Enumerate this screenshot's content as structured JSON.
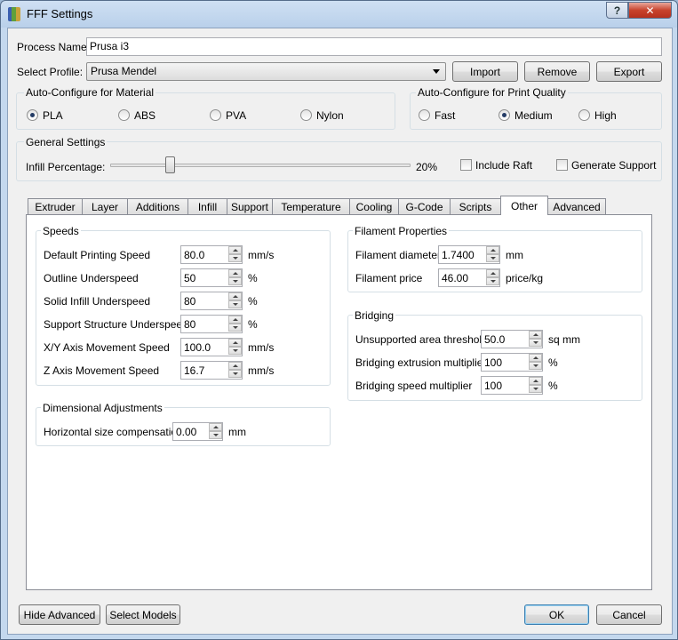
{
  "window": {
    "title": "FFF Settings",
    "help_label": "?",
    "close_label": "✕"
  },
  "process": {
    "name_label": "Process Name:",
    "name_value": "Prusa i3"
  },
  "profile": {
    "label": "Select Profile:",
    "selected": "Prusa Mendel",
    "import_label": "Import",
    "remove_label": "Remove",
    "export_label": "Export"
  },
  "material": {
    "title": "Auto-Configure for Material",
    "options": [
      "PLA",
      "ABS",
      "PVA",
      "Nylon"
    ],
    "selected": "PLA"
  },
  "quality": {
    "title": "Auto-Configure for Print Quality",
    "options": [
      "Fast",
      "Medium",
      "High"
    ],
    "selected": "Medium"
  },
  "general": {
    "title": "General Settings",
    "infill_label": "Infill Percentage:",
    "infill_value_text": "20%",
    "infill_fraction": 0.2,
    "include_raft_label": "Include Raft",
    "include_raft_checked": false,
    "generate_support_label": "Generate Support",
    "generate_support_checked": false
  },
  "tabs": [
    "Extruder",
    "Layer",
    "Additions",
    "Infill",
    "Support",
    "Temperature",
    "Cooling",
    "G-Code",
    "Scripts",
    "Other",
    "Advanced"
  ],
  "active_tab": "Other",
  "speeds": {
    "title": "Speeds",
    "rows": [
      {
        "label": "Default Printing Speed",
        "value": "80.0",
        "unit": "mm/s"
      },
      {
        "label": "Outline Underspeed",
        "value": "50",
        "unit": "%"
      },
      {
        "label": "Solid Infill Underspeed",
        "value": "80",
        "unit": "%"
      },
      {
        "label": "Support Structure Underspeed",
        "value": "80",
        "unit": "%"
      },
      {
        "label": "X/Y Axis Movement Speed",
        "value": "100.0",
        "unit": "mm/s"
      },
      {
        "label": "Z Axis Movement Speed",
        "value": "16.7",
        "unit": "mm/s"
      }
    ]
  },
  "dimensional": {
    "title": "Dimensional Adjustments",
    "rows": [
      {
        "label": "Horizontal size compensation",
        "value": "0.00",
        "unit": "mm"
      }
    ]
  },
  "filament": {
    "title": "Filament Properties",
    "rows": [
      {
        "label": "Filament diameter",
        "value": "1.7400",
        "unit": "mm"
      },
      {
        "label": "Filament price",
        "value": "46.00",
        "unit": "price/kg"
      }
    ]
  },
  "bridging": {
    "title": "Bridging",
    "rows": [
      {
        "label": "Unsupported area threshold",
        "value": "50.0",
        "unit": "sq mm"
      },
      {
        "label": "Bridging extrusion multiplier",
        "value": "100",
        "unit": "%"
      },
      {
        "label": "Bridging speed multiplier",
        "value": "100",
        "unit": "%"
      }
    ]
  },
  "footer": {
    "hide_advanced_label": "Hide Advanced",
    "select_models_label": "Select Models",
    "ok_label": "OK",
    "cancel_label": "Cancel"
  },
  "colors": {
    "titlebar": "#c4d8ee",
    "dialog_bg": "#f0f0f0",
    "close_red": "#c8432d",
    "default_button_border": "#3c7fb1"
  }
}
